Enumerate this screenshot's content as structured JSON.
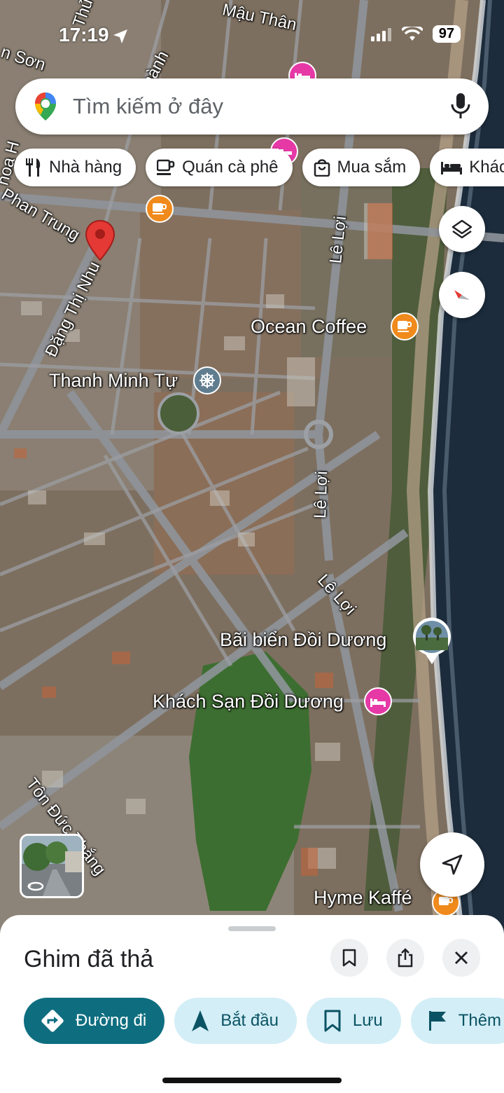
{
  "status_bar": {
    "time": "17:19",
    "battery": "97"
  },
  "search": {
    "placeholder": "Tìm kiếm ở đây"
  },
  "chips": [
    {
      "label": "Nhà hàng",
      "icon": "fork-knife-icon"
    },
    {
      "label": "Quán cà phê",
      "icon": "coffee-cup-icon"
    },
    {
      "label": "Mua sắm",
      "icon": "shopping-bag-icon"
    },
    {
      "label": "Khác",
      "icon": "bed-icon"
    }
  ],
  "map": {
    "places": {
      "ocean_coffee": "Ocean Coffee",
      "thanh_minh_tu": "Thanh Minh Tự",
      "bai_bien": "Bãi biển Đồi Dương",
      "khach_san": "Khách Sạn Đồi Dương",
      "hyme_kaffe": "Hyme Kaffé"
    },
    "roads": {
      "mau_than": "Mậu Thân",
      "phan_trung": "Phan Trung",
      "dang_thi_nhu": "Đặng Thị Nhu",
      "le_loi_1": "Lê Lợi",
      "le_loi_2": "Lê Lợi",
      "le_loi_3": "Lê Lợi",
      "ton_duc_thang": "Tôn Đức Thắng",
      "son": "n Sơn",
      "thanh": "hành",
      "thu": "Thủ",
      "hoa": "hoa H"
    },
    "colors": {
      "sea": "#1c2c3c",
      "vegetation": "#3a6b2e",
      "pin": "#e53935"
    }
  },
  "sheet": {
    "title": "Ghim đã thả",
    "actions": [
      {
        "label": "Đường đi"
      },
      {
        "label": "Bắt đầu"
      },
      {
        "label": "Lưu"
      },
      {
        "label": "Thêm"
      }
    ]
  }
}
